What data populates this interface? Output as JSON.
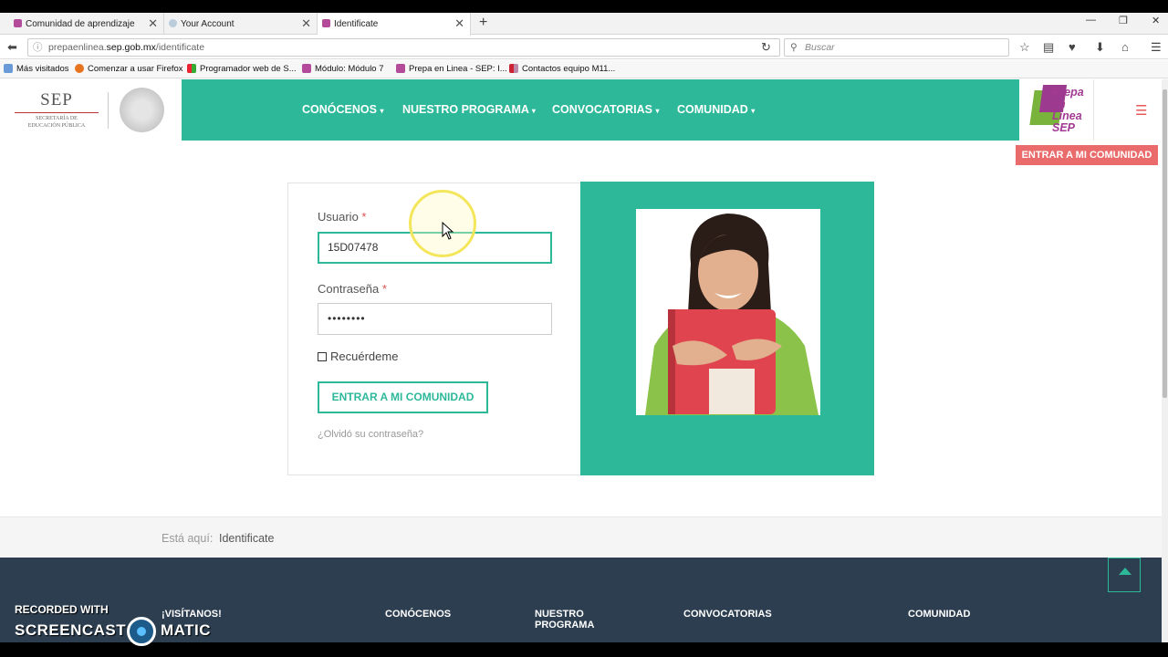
{
  "browser": {
    "tabs": [
      {
        "title": "Comunidad de aprendizaje"
      },
      {
        "title": "Your Account"
      },
      {
        "title": "Identificate"
      }
    ],
    "url_prefix": "prepaenlinea.",
    "url_domain": "sep.gob.mx",
    "url_path": "/identificate",
    "search_placeholder": "Buscar",
    "bookmarks": [
      "Más visitados",
      "Comenzar a usar Firefox",
      "Programador web de S...",
      "Módulo: Módulo 7",
      "Prepa en Linea - SEP: I...",
      "Contactos equipo M11..."
    ]
  },
  "header": {
    "sep_title": "SEP",
    "sep_subtitle_1": "SECRETARÍA DE",
    "sep_subtitle_2": "EDUCACIÓN PÚBLICA",
    "menu": [
      {
        "label": "CONÓCENOS"
      },
      {
        "label": "NUESTRO PROGRAMA"
      },
      {
        "label": "CONVOCATORIAS"
      },
      {
        "label": "COMUNIDAD"
      }
    ],
    "prepa_logo_text": "Prepa en Línea SEP",
    "enter_community": "ENTRAR A MI COMUNIDAD"
  },
  "login": {
    "user_label": "Usuario",
    "user_value": "15D07478",
    "password_label": "Contraseña",
    "password_value": "••••••••",
    "required_mark": "*",
    "remember_label": "Recuérdeme",
    "submit_label": "ENTRAR A MI COMUNIDAD",
    "forgot_label": "¿Olvidó su contraseña?"
  },
  "breadcrumb": {
    "label": "Está aquí:",
    "current": "Identificate"
  },
  "footer": {
    "columns": [
      "¡VISÍTANOS!",
      "CONÓCENOS",
      "NUESTRO PROGRAMA",
      "CONVOCATORIAS",
      "COMUNIDAD"
    ]
  },
  "watermark": {
    "line1": "RECORDED WITH",
    "line2a": "SCREENCAST",
    "line2b": "MATIC"
  },
  "colors": {
    "brand_teal": "#2db89a",
    "accent_red": "#ea6b6b",
    "footer_bg": "#2c3e50"
  }
}
